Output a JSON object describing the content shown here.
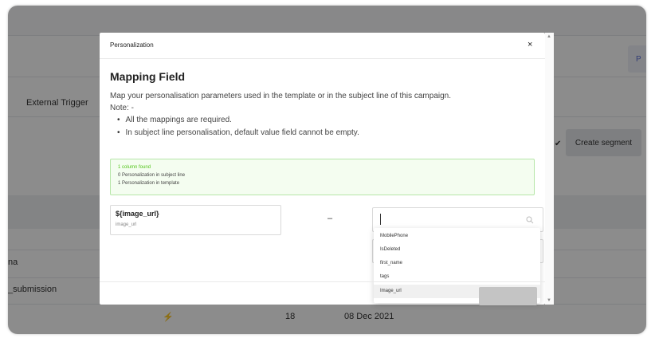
{
  "background": {
    "tab_label": "External Trigger",
    "create_segment_label": "Create segment",
    "p_button_label": "P",
    "row1_label": "na",
    "row2_label": "_submission",
    "row3_count": "18",
    "row3_date": "08 Dec 2021"
  },
  "modal": {
    "header_title": "Personalization",
    "close_label": "×",
    "title": "Mapping Field",
    "description": "Map your personalisation parameters used in the template or in the subject line of this campaign.",
    "note_label": "Note: -",
    "bullets": [
      "All the mappings are required.",
      "In subject line personalisation, default value field cannot be empty."
    ],
    "info": {
      "found": "1 column found",
      "subject": "0 Personalization in subject line",
      "template": "1 Personalization in template"
    },
    "field": {
      "token": "${image_url}",
      "sub": "image_url"
    },
    "dash": "–",
    "dropdown_options": [
      "MobilePhone",
      "IsDeleted",
      "first_name",
      "tags",
      "Image_url"
    ]
  },
  "colors": {
    "overlay": "#000000",
    "info_bg": "#f4fdf0",
    "info_border": "#b6e6a8",
    "found_text": "#52c41a"
  }
}
